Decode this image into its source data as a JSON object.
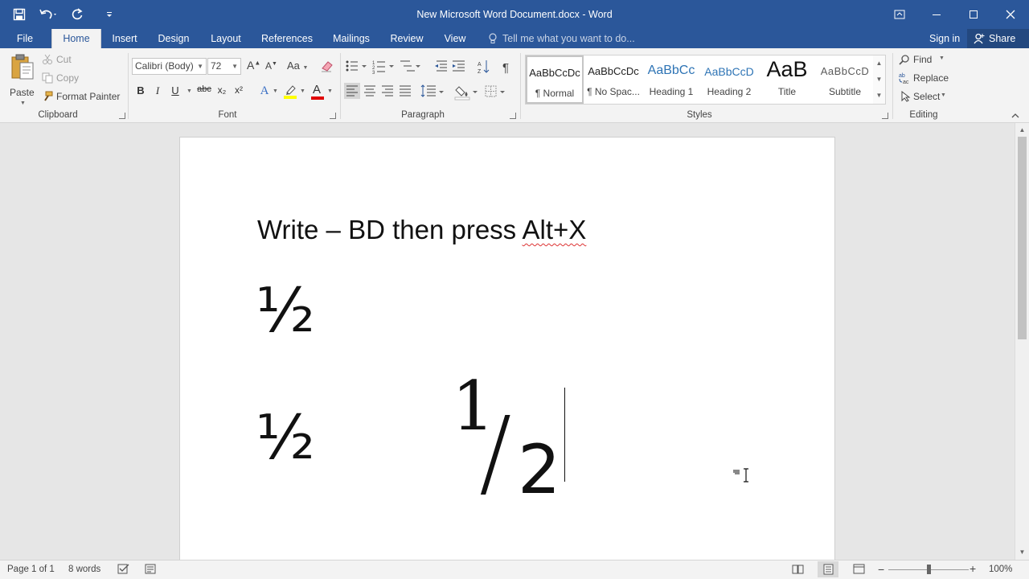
{
  "window": {
    "title": "New Microsoft Word Document.docx - Word"
  },
  "tabs": [
    "File",
    "Home",
    "Insert",
    "Design",
    "Layout",
    "References",
    "Mailings",
    "Review",
    "View"
  ],
  "active_tab": "Home",
  "tell_me": "Tell me what you want to do...",
  "account": {
    "sign_in": "Sign in",
    "share": "Share"
  },
  "clipboard": {
    "paste": "Paste",
    "cut": "Cut",
    "copy": "Copy",
    "format_painter": "Format Painter",
    "label": "Clipboard"
  },
  "font": {
    "name": "Calibri (Body)",
    "size": "72",
    "bold": "B",
    "italic": "I",
    "underline": "U",
    "strike": "abc",
    "subscript": "x₂",
    "superscript": "x²",
    "grow": "A",
    "shrink": "A",
    "change_case": "Aa",
    "text_effects": "A",
    "font_color_glyph": "A",
    "label": "Font",
    "highlight_color": "#ffff00",
    "font_color": "#e00000"
  },
  "paragraph": {
    "label": "Paragraph"
  },
  "styles": {
    "label": "Styles",
    "items": [
      {
        "sample": "AaBbCcDc",
        "name": "¶ Normal"
      },
      {
        "sample": "AaBbCcDc",
        "name": "¶ No Spac..."
      },
      {
        "sample": "AaBbCc",
        "name": "Heading 1"
      },
      {
        "sample": "AaBbCcD",
        "name": "Heading 2"
      },
      {
        "sample": "AaB",
        "name": "Title"
      },
      {
        "sample": "AaBbCcD",
        "name": "Subtitle"
      }
    ]
  },
  "editing": {
    "label": "Editing",
    "find": "Find",
    "replace": "Replace",
    "select": "Select"
  },
  "document": {
    "line1_prefix": "Write – BD then press ",
    "line1_keys": "Alt+X",
    "fraction_glyph": "½",
    "fraction_glyph_2": "½",
    "numerator": "1",
    "slash": "/",
    "denominator": "2"
  },
  "status": {
    "page": "Page 1 of 1",
    "words": "8 words",
    "zoom": "100%",
    "zoom_level_percent": 100
  },
  "colors": {
    "brand": "#2b579a",
    "ribbon_bg": "#f3f3f3",
    "canvas_bg": "#e6e6e6"
  }
}
